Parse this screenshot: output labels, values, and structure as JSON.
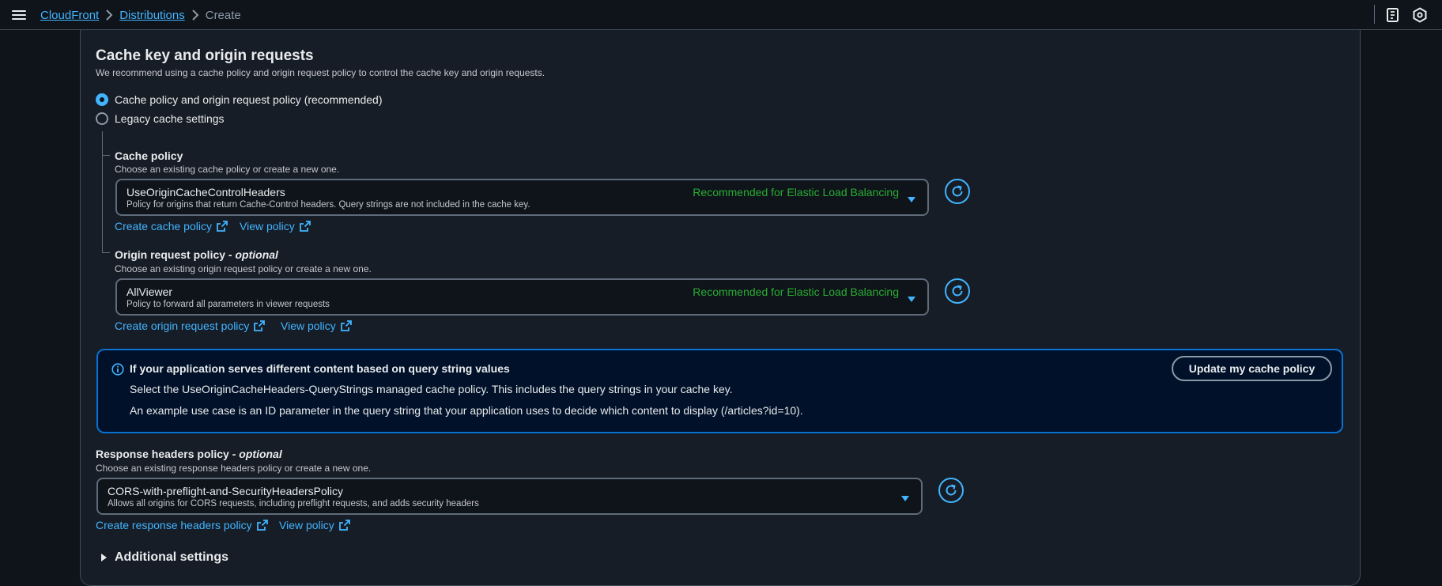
{
  "breadcrumb": {
    "items": [
      "CloudFront",
      "Distributions"
    ],
    "current": "Create"
  },
  "section": {
    "title": "Cache key and origin requests",
    "description": "We recommend using a cache policy and origin request policy to control the cache key and origin requests."
  },
  "options": {
    "recommended": "Cache policy and origin request policy (recommended)",
    "legacy": "Legacy cache settings",
    "selected": "recommended"
  },
  "cache_policy": {
    "label": "Cache policy",
    "description": "Choose an existing cache policy or create a new one.",
    "value": "UseOriginCacheControlHeaders",
    "value_description": "Policy for origins that return Cache-Control headers. Query strings are not included in the cache key.",
    "tag": "Recommended for Elastic Load Balancing",
    "create_link": "Create cache policy",
    "view_link": "View policy"
  },
  "origin_request_policy": {
    "label": "Origin request policy -",
    "label_optional": "optional",
    "description": "Choose an existing origin request policy or create a new one.",
    "value": "AllViewer",
    "value_description": "Policy to forward all parameters in viewer requests",
    "tag": "Recommended for Elastic Load Balancing",
    "create_link": "Create origin request policy",
    "view_link": "View policy"
  },
  "info": {
    "title": "If your application serves different content based on query string values",
    "line1": "Select the UseOriginCacheHeaders-QueryStrings managed cache policy. This includes the query strings in your cache key.",
    "line2": "An example use case is an ID parameter in the query string that your application uses to decide which content to display (/articles?id=10).",
    "button": "Update my cache policy"
  },
  "response_headers_policy": {
    "label": "Response headers policy -",
    "label_optional": "optional",
    "description": "Choose an existing response headers policy or create a new one.",
    "value": "CORS-with-preflight-and-SecurityHeadersPolicy",
    "value_description": "Allows all origins for CORS requests, including preflight requests, and adds security headers",
    "create_link": "Create response headers policy",
    "view_link": "View policy"
  },
  "additional_settings": "Additional settings",
  "colors": {
    "background": "#0f141a",
    "panel": "#161d26",
    "link": "#42b4ff",
    "success": "#29ad32",
    "info_border": "#0972d3"
  }
}
